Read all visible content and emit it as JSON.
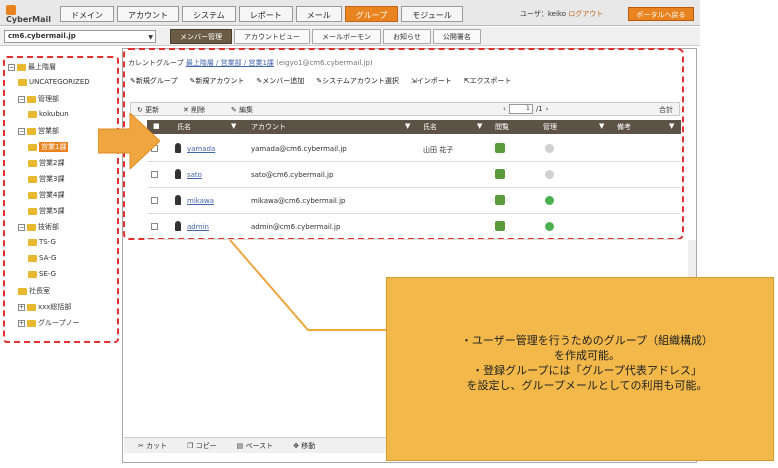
{
  "app": {
    "logo": "CyberMail"
  },
  "nav": {
    "tabs": [
      "ドメイン",
      "アカウント",
      "システム",
      "レポート",
      "メール",
      "グループ",
      "モジュール"
    ],
    "active_index": 5
  },
  "user": {
    "prefix": "ユーザ：keiko",
    "logout": "ログアウト",
    "portal": "ポータルへ戻る"
  },
  "domain": {
    "selected": "cm6.cybermail.jp"
  },
  "subtabs": {
    "items": [
      "メンバー管理",
      "アカウントビュー",
      "メールボーモン",
      "お知らせ",
      "公開署名"
    ],
    "active_index": 0
  },
  "tree": {
    "items": [
      {
        "label": "最上階層",
        "toggle": "−"
      },
      {
        "label": "UNCATEGORIZED"
      },
      {
        "label": "管理部",
        "toggle": "−"
      },
      {
        "label": "kokubun"
      },
      {
        "label": "営業部",
        "toggle": "−"
      },
      {
        "label": "営業1課",
        "selected": true
      },
      {
        "label": "営業2課"
      },
      {
        "label": "営業3課"
      },
      {
        "label": "営業4課"
      },
      {
        "label": "営業5課"
      },
      {
        "label": "技術部",
        "toggle": "−"
      },
      {
        "label": "TS-G"
      },
      {
        "label": "SA-G"
      },
      {
        "label": "SE-G"
      },
      {
        "label": "社長室"
      },
      {
        "label": "xxx総括部",
        "toggle": "+"
      },
      {
        "label": "グループノー",
        "toggle": "+"
      }
    ]
  },
  "breadcrumb": {
    "prefix": "カレントグループ",
    "path": "最上階層 / 営業部 / 営業1課",
    "email": "(eigyo1@cm6.cybermail.jp)"
  },
  "actions": [
    "新規グループ",
    "新規アカウント",
    "メンバー追加",
    "システムアカウント選択",
    "インポート",
    "エクスポート"
  ],
  "grid_toolbar": {
    "update": "更新",
    "delete": "削除",
    "edit": "編集",
    "page": "1",
    "page_suffix": "/1",
    "total": "合計"
  },
  "columns": [
    "氏名",
    "アカウント",
    "氏名",
    "閲覧",
    "管理",
    "備考"
  ],
  "rows": [
    {
      "name": "yamada",
      "account": "yamada@cm6.cybermail.jp",
      "fullname": "山田 花子",
      "admin": "gray"
    },
    {
      "name": "sato",
      "account": "sato@cm6.cybermail.jp",
      "fullname": "",
      "admin": "gray"
    },
    {
      "name": "mikawa",
      "account": "mikawa@cm6.cybermail.jp",
      "fullname": "",
      "admin": "green"
    },
    {
      "name": "admin",
      "account": "admin@cm6.cybermail.jp",
      "fullname": "",
      "admin": "green"
    }
  ],
  "bottombar": [
    "カット",
    "コピー",
    "ペースト",
    "移動"
  ],
  "callout": {
    "line1": "・ユーザー管理を行うためのグループ（組織構成）",
    "line2": "を作成可能。",
    "line3": "・登録グループには「グループ代表アドレス」",
    "line4": "を設定し、グループメールとしての利用も可能。"
  },
  "colors": {
    "accent": "#e8831f",
    "header": "#5c5346",
    "dashed": "#e03030",
    "callout": "#f2b84a"
  }
}
